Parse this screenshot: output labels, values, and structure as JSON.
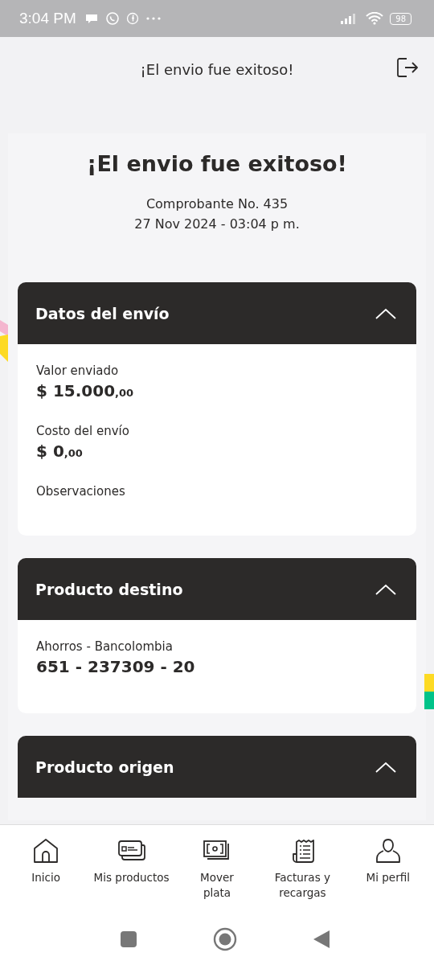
{
  "status_bar": {
    "time": "3:04 PM",
    "battery": "98"
  },
  "header": {
    "title": "¡El envio fue exitoso!"
  },
  "receipt": {
    "title": "¡El envio fue exitoso!",
    "number": "Comprobante No. 435",
    "date": "27 Nov 2024 - 03:04 p m."
  },
  "sections": [
    {
      "title": "Datos del envío",
      "expanded": true,
      "fields": [
        {
          "label": "Valor enviado",
          "value": "$ 15.000",
          "cents": ",00"
        },
        {
          "label": "Costo del envío",
          "value": "$ 0",
          "cents": ",00"
        },
        {
          "label": "Observaciones"
        }
      ]
    },
    {
      "title": "Producto destino",
      "expanded": true,
      "fields": [
        {
          "label": "Ahorros - Bancolombia",
          "value": "651 - 237309 - 20"
        }
      ]
    },
    {
      "title": "Producto origen",
      "expanded": true
    }
  ],
  "bottom_nav": [
    {
      "kind": "home",
      "label": "Inicio"
    },
    {
      "kind": "cards",
      "label": "Mis productos"
    },
    {
      "kind": "money",
      "label": "Mover plata"
    },
    {
      "kind": "bill",
      "label": "Facturas y recargas"
    },
    {
      "kind": "profile",
      "label": "Mi perfil"
    }
  ]
}
